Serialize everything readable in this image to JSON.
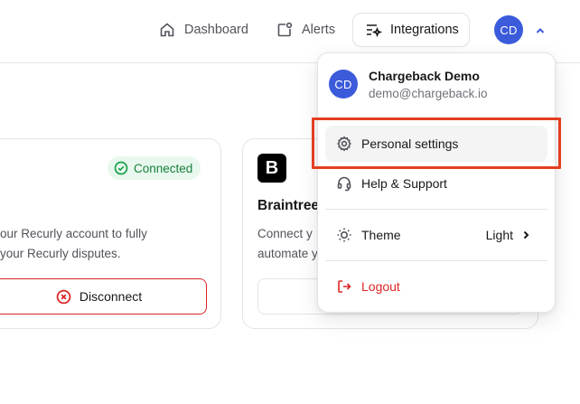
{
  "nav": {
    "dashboard_label": "Dashboard",
    "alerts_label": "Alerts",
    "integrations_label": "Integrations",
    "avatar_initials": "CD"
  },
  "recurly_card": {
    "status_badge": "Connected",
    "description_line1": "our Recurly account to fully",
    "description_line2": "your Recurly disputes.",
    "disconnect_label": "Disconnect"
  },
  "braintree_card": {
    "logo_letter": "B",
    "title": "Braintree",
    "description_line1": "Connect y",
    "description_line2": "automate y"
  },
  "user_menu": {
    "avatar_initials": "CD",
    "name": "Chargeback Demo",
    "email": "demo@chargeback.io",
    "items": [
      {
        "label": "Personal settings",
        "icon": "gear-icon"
      },
      {
        "label": "Help & Support",
        "icon": "headset-icon"
      },
      {
        "label": "Theme",
        "icon": "sun-icon",
        "value": "Light"
      },
      {
        "label": "Logout",
        "icon": "logout-icon"
      }
    ]
  },
  "colors": {
    "accent": "#3b5bdb",
    "success": "#16a34a",
    "danger": "#dc2626",
    "annotation": "#e53e22"
  }
}
